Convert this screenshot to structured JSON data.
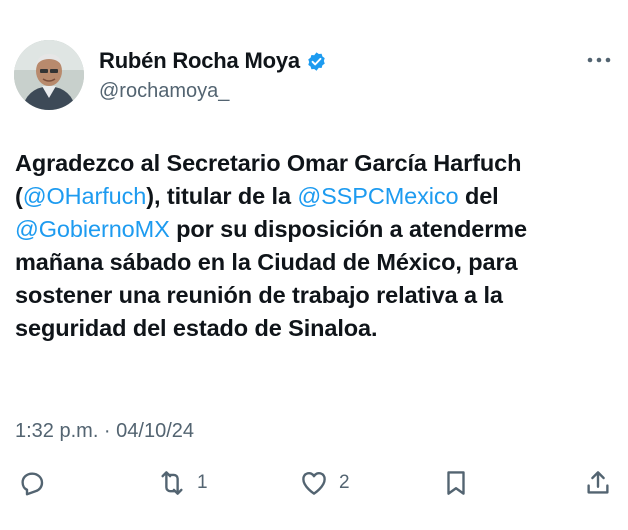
{
  "author": {
    "name": "Rubén Rocha Moya",
    "handle": "@rochamoya_",
    "verified_icon": "verified-badge-icon",
    "avatar_icon": "profile-photo"
  },
  "tweet": {
    "p1": "Agradezco al Secretario Omar García Harfuch",
    "p2": "(",
    "m1": "@OHarfuch",
    "p3": "), titular de la ",
    "m2": "@SSPCMexico",
    "p4": " del",
    "m3": "@GobiernoMX",
    "p5": " por su disposición a atenderme mañana sábado en la Ciudad de México, para sostener una reunión de trabajo relativa a la seguridad del estado de Sinaloa."
  },
  "meta": {
    "timestamp": "1:32 p.m. · 04/10/24"
  },
  "actions": {
    "reply_count": "",
    "retweet_count": "1",
    "like_count": "2"
  },
  "colors": {
    "accent": "#1d9bf0",
    "text": "#0f1419",
    "muted": "#536471"
  }
}
